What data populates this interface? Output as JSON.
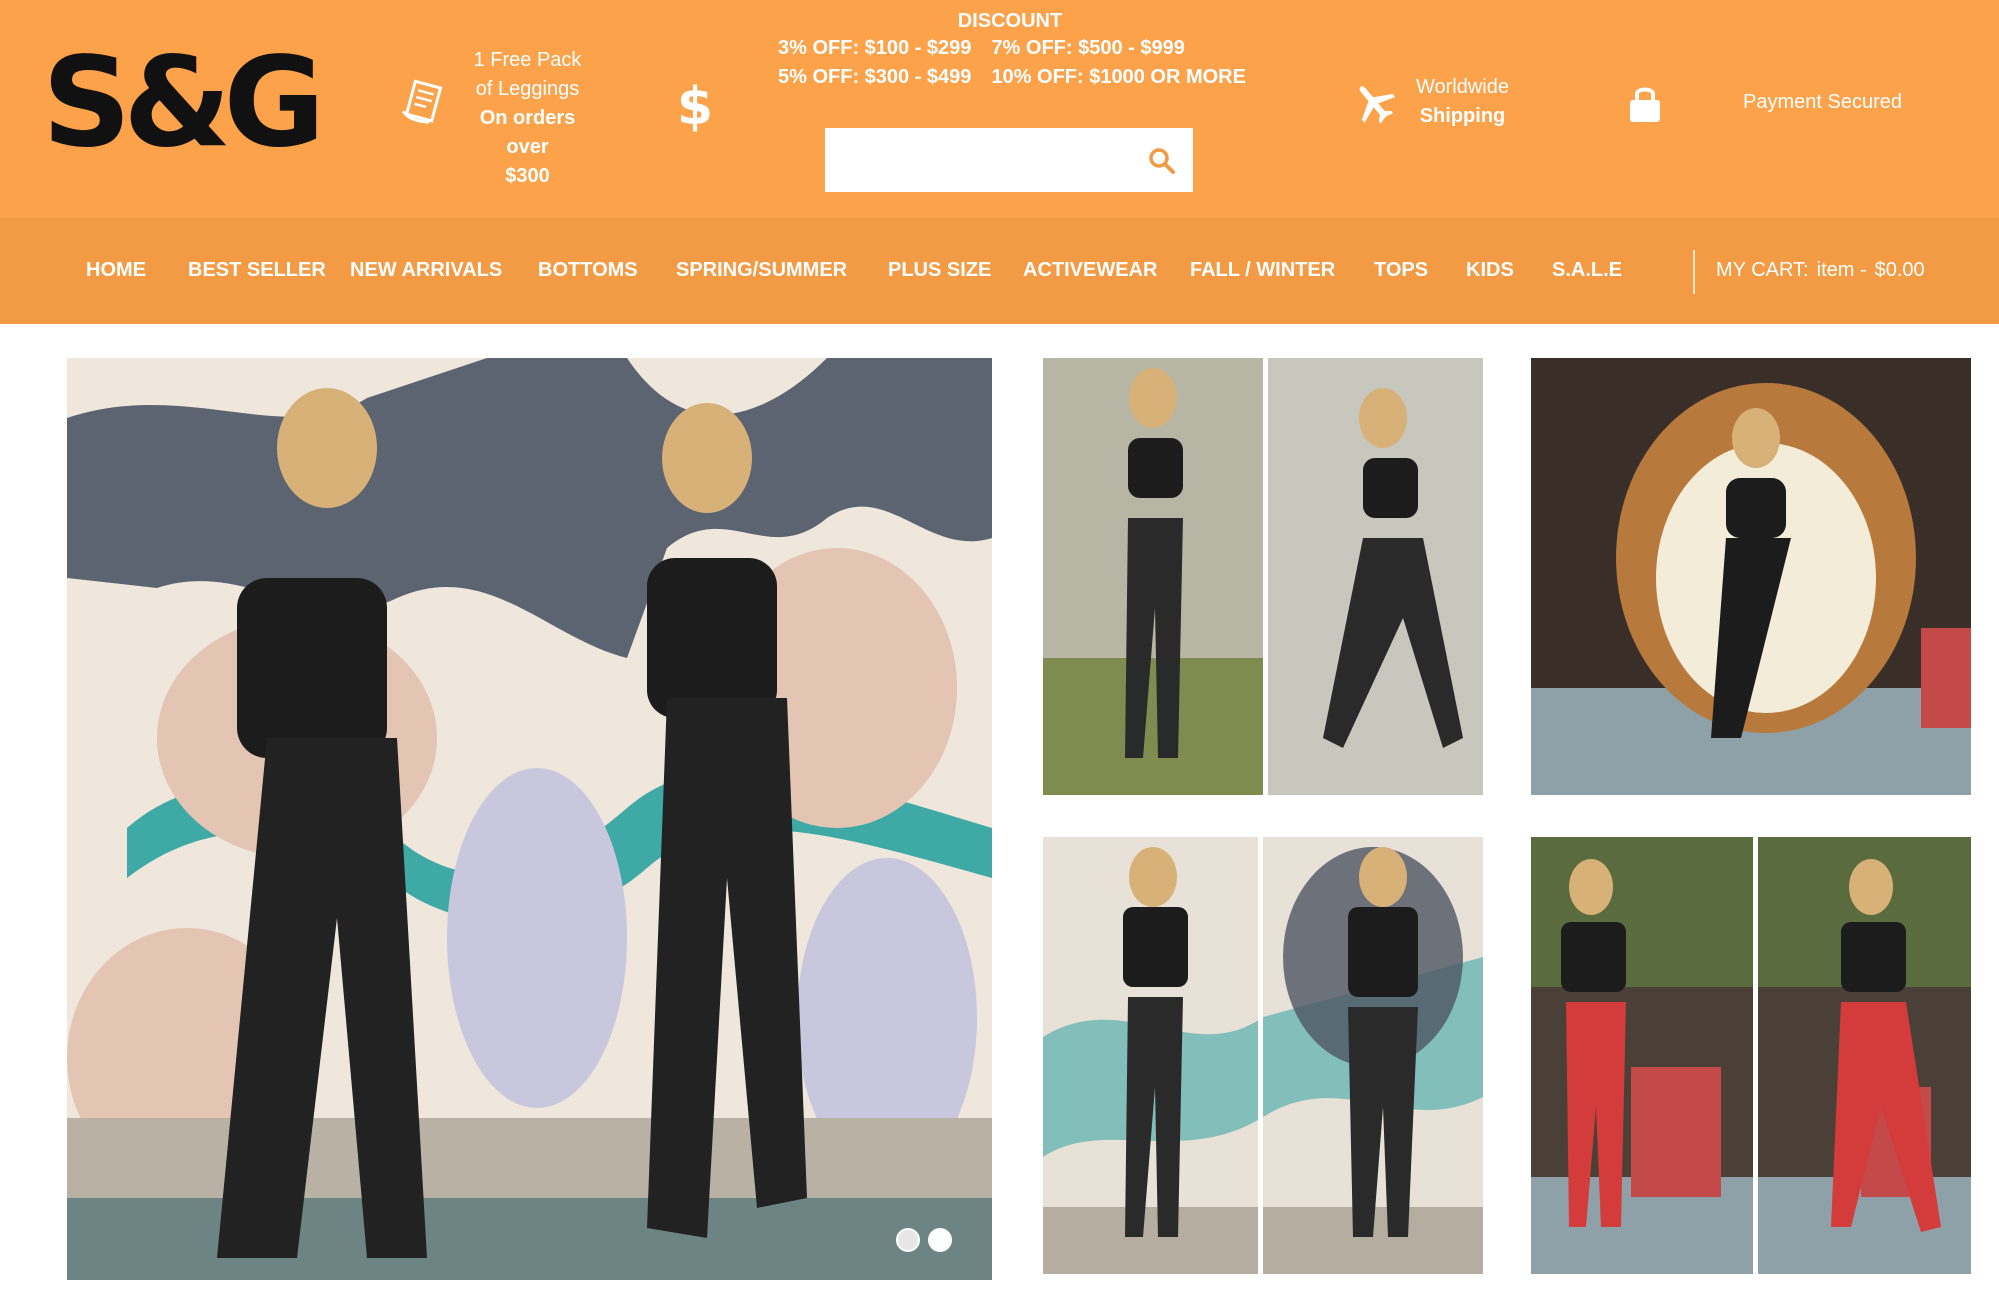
{
  "brand": {
    "logo_text": "S&G"
  },
  "header": {
    "free_pack": {
      "line1": "1 Free Pack",
      "line2": "of Leggings",
      "line3": "On orders",
      "line4": "over",
      "line5": "$300"
    },
    "discount": {
      "title": "DISCOUNT",
      "tier1": "3% OFF: $100 - $299",
      "tier2": "7% OFF: $500 - $999",
      "tier3": "5% OFF: $300 - $499",
      "tier4": "10% OFF: $1000 OR MORE"
    },
    "search": {
      "placeholder": ""
    },
    "shipping": {
      "line1": "Worldwide",
      "line2": "Shipping"
    },
    "payment": {
      "label": "Payment Secured"
    }
  },
  "nav": {
    "items": [
      {
        "label": "HOME"
      },
      {
        "label": "BEST SELLER"
      },
      {
        "label": "NEW ARRIVALS"
      },
      {
        "label": "BOTTOMS"
      },
      {
        "label": "SPRING/SUMMER"
      },
      {
        "label": "PLUS SIZE"
      },
      {
        "label": "ACTIVEWEAR"
      },
      {
        "label": "FALL / WINTER"
      },
      {
        "label": "TOPS"
      },
      {
        "label": "KIDS"
      },
      {
        "label": "S.A.L.E"
      }
    ],
    "cart": {
      "label": "MY CART:",
      "items": "item -",
      "total": "$0.00"
    }
  },
  "hero": {
    "slide_count": 2,
    "active_slide": 2
  },
  "colors": {
    "header_bg": "#fba24a",
    "nav_bg": "#f39a44",
    "text": "#ffffff"
  },
  "icons": [
    "receipt-icon",
    "dollar-icon",
    "search-icon",
    "airplane-icon",
    "lock-icon"
  ]
}
